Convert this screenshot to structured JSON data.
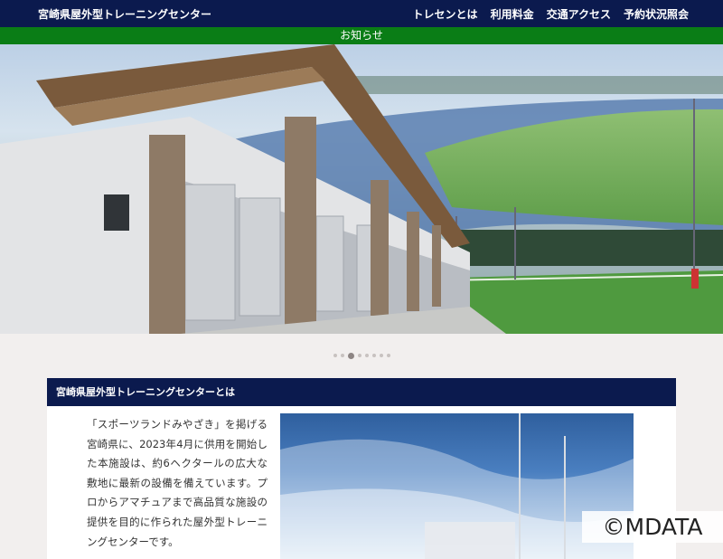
{
  "header": {
    "site_title": "宮崎県屋外型トレーニングセンター",
    "nav": [
      {
        "label": "トレセンとは"
      },
      {
        "label": "利用料金"
      },
      {
        "label": "交通アクセス"
      },
      {
        "label": "予約状況照会"
      }
    ]
  },
  "notice": {
    "label": "お知らせ"
  },
  "slider": {
    "slide_count": 8,
    "active_index": 2
  },
  "about": {
    "heading": "宮崎県屋外型トレーニングセンターとは",
    "body": "「スポーツランドみやざき」を掲げる宮崎県に、2023年4月に供用を開始した本施設は、約6ヘクタールの広大な敷地に最新の設備を備えています。プロからアマチュアまで高品質な施設の提供を目的に作られた屋外型トレーニングセンターです。"
  },
  "watermark": {
    "text": "©MDATA"
  },
  "colors": {
    "header_bg": "#0b1a4e",
    "notice_bg": "#0a7d16",
    "page_bg": "#f2efee"
  }
}
